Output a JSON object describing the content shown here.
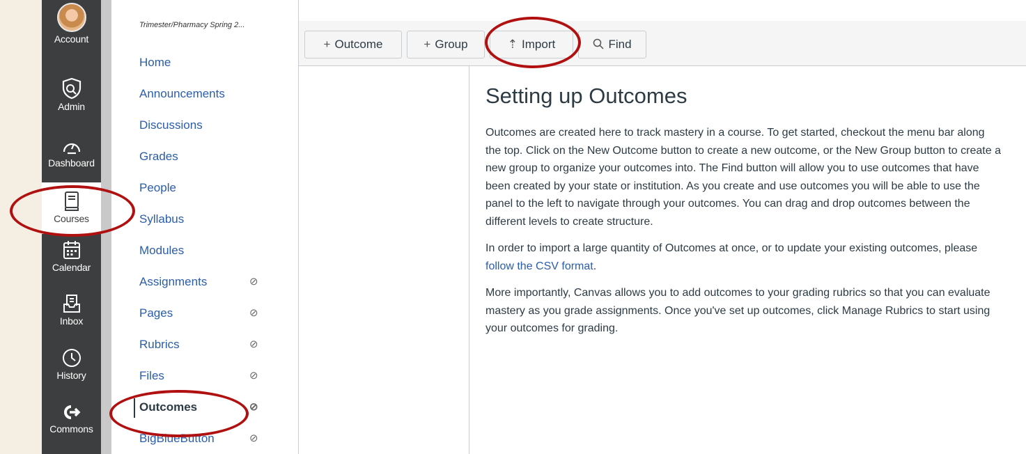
{
  "global_nav": {
    "items": [
      {
        "label": "Account",
        "icon": "avatar"
      },
      {
        "label": "Admin",
        "icon": "shield-icon"
      },
      {
        "label": "Dashboard",
        "icon": "speedometer-icon"
      },
      {
        "label": "Courses",
        "icon": "book-icon"
      },
      {
        "label": "Calendar",
        "icon": "calendar-icon"
      },
      {
        "label": "Inbox",
        "icon": "inbox-icon"
      },
      {
        "label": "History",
        "icon": "clock-icon"
      },
      {
        "label": "Commons",
        "icon": "commons-icon"
      }
    ]
  },
  "course": {
    "breadcrumb": "Trimester/Pharmacy Spring 2...",
    "nav": [
      {
        "label": "Home",
        "hidden": false
      },
      {
        "label": "Announcements",
        "hidden": false
      },
      {
        "label": "Discussions",
        "hidden": false
      },
      {
        "label": "Grades",
        "hidden": false
      },
      {
        "label": "People",
        "hidden": false
      },
      {
        "label": "Syllabus",
        "hidden": false
      },
      {
        "label": "Modules",
        "hidden": false
      },
      {
        "label": "Assignments",
        "hidden": true
      },
      {
        "label": "Pages",
        "hidden": true
      },
      {
        "label": "Rubrics",
        "hidden": true
      },
      {
        "label": "Files",
        "hidden": true
      },
      {
        "label": "Outcomes",
        "hidden": true
      },
      {
        "label": "BigBlueButton",
        "hidden": true
      }
    ]
  },
  "toolbar": {
    "outcome_label": "Outcome",
    "group_label": "Group",
    "import_label": "Import",
    "find_label": "Find"
  },
  "content": {
    "title": "Setting up Outcomes",
    "para1": "Outcomes are created here to track mastery in a course. To get started, checkout the menu bar along the top. Click on the New Outcome button to create a new outcome, or the New Group button to create a new group to organize your outcomes into. The Find button will allow you to use outcomes that have been created by your state or institution. As you create and use outcomes you will be able to use the panel to the left to navigate through your outcomes. You can drag and drop outcomes between the different levels to create structure.",
    "para2_prefix": "In order to import a large quantity of Outcomes at once, or to update your existing outcomes, please ",
    "para2_link": "follow the CSV format",
    "para2_suffix": ".",
    "para3": "More importantly, Canvas allows you to add outcomes to your grading rubrics so that you can evaluate mastery as you grade assignments. Once you've set up outcomes, click Manage Rubrics to start using your outcomes for grading."
  },
  "colors": {
    "nav_bg": "#3d3e3f",
    "link": "#2b5dab",
    "annotation": "#b01010"
  }
}
